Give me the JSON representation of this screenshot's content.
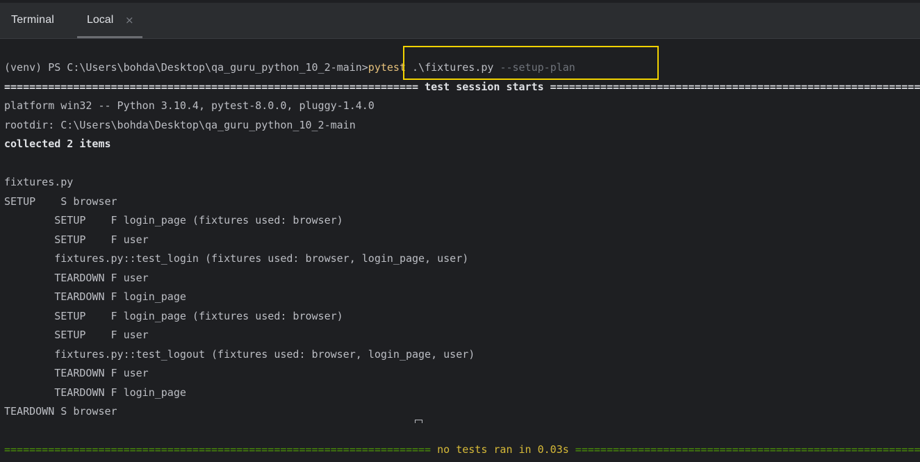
{
  "topbar": {
    "title": "Terminal",
    "tab_label": "Local",
    "tab_close": "×"
  },
  "terminal": {
    "prompt": "(venv) PS C:\\Users\\bohda\\Desktop\\qa_guru_python_10_2-main>",
    "cmd": "pytest",
    "cmd_args": " .\\fixtures.py ",
    "cmd_option": "--setup-plan",
    "session_starts": "================================================================== test session starts ==================================================================",
    "platform": "platform win32 -- Python 3.10.4, pytest-8.0.0, pluggy-1.4.0",
    "rootdir": "rootdir: C:\\Users\\bohda\\Desktop\\qa_guru_python_10_2-main",
    "collected": "collected 2 items",
    "file": "fixtures.py",
    "plan": [
      "SETUP    S browser",
      "        SETUP    F login_page (fixtures used: browser)",
      "        SETUP    F user",
      "        fixtures.py::test_login (fixtures used: browser, login_page, user)",
      "        TEARDOWN F user",
      "        TEARDOWN F login_page",
      "        SETUP    F login_page (fixtures used: browser)",
      "        SETUP    F user",
      "        fixtures.py::test_logout (fixtures used: browser, login_page, user)",
      "        TEARDOWN F user",
      "        TEARDOWN F login_page",
      "TEARDOWN S browser"
    ],
    "summary_left": "==================================================================== ",
    "summary_text": "no tests ran in 0.03s",
    "summary_right": " ===================================================================="
  },
  "colors": {
    "background": "#1e1f22",
    "highlight": "#f2d200",
    "command": "#e5c07b",
    "summary_rule": "#4e9a06"
  }
}
